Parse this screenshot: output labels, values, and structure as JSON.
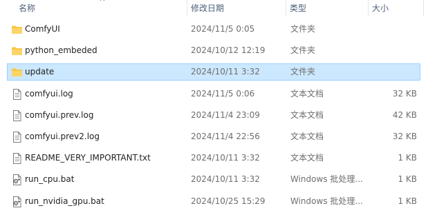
{
  "columns": {
    "name": "名称",
    "modified": "修改日期",
    "type": "类型",
    "size": "大小"
  },
  "files": [
    {
      "name": "ComfyUI",
      "modified": "2024/11/5 0:05",
      "type": "文件夹",
      "size": "",
      "icon": "folder-icon",
      "selected": false
    },
    {
      "name": "python_embeded",
      "modified": "2024/10/12 12:19",
      "type": "文件夹",
      "size": "",
      "icon": "folder-icon",
      "selected": false
    },
    {
      "name": "update",
      "modified": "2024/10/11 3:32",
      "type": "文件夹",
      "size": "",
      "icon": "folder-icon",
      "selected": true
    },
    {
      "name": "comfyui.log",
      "modified": "2024/11/5 0:06",
      "type": "文本文档",
      "size": "32 KB",
      "icon": "text-file-icon",
      "selected": false
    },
    {
      "name": "comfyui.prev.log",
      "modified": "2024/11/4 23:09",
      "type": "文本文档",
      "size": "42 KB",
      "icon": "text-file-icon",
      "selected": false
    },
    {
      "name": "comfyui.prev2.log",
      "modified": "2024/11/4 22:56",
      "type": "文本文档",
      "size": "32 KB",
      "icon": "text-file-icon",
      "selected": false
    },
    {
      "name": "README_VERY_IMPORTANT.txt",
      "modified": "2024/10/11 3:32",
      "type": "文本文档",
      "size": "1 KB",
      "icon": "text-file-icon",
      "selected": false
    },
    {
      "name": "run_cpu.bat",
      "modified": "2024/10/11 3:32",
      "type": "Windows 批处理...",
      "size": "1 KB",
      "icon": "batch-file-icon",
      "selected": false
    },
    {
      "name": "run_nvidia_gpu.bat",
      "modified": "2024/10/25 15:29",
      "type": "Windows 批处理...",
      "size": "1 KB",
      "icon": "batch-file-icon",
      "selected": false
    }
  ],
  "colors": {
    "folder": "#f8c648",
    "selection_bg": "#cce8ff",
    "selection_border": "#99d1ff",
    "header_text": "#4c607a"
  }
}
